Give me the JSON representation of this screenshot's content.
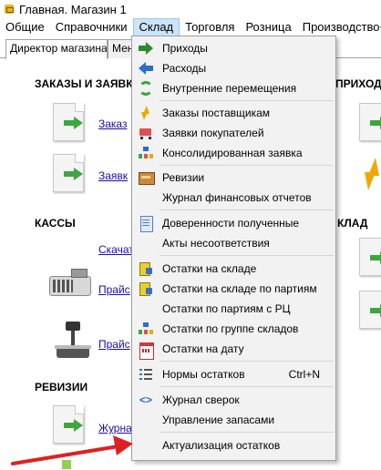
{
  "window": {
    "title": "Главная. Магазин 1"
  },
  "menubar": {
    "items": [
      {
        "label": "Общие"
      },
      {
        "label": "Справочники"
      },
      {
        "label": "Склад"
      },
      {
        "label": "Торговля"
      },
      {
        "label": "Розница"
      },
      {
        "label": "Производство+"
      }
    ]
  },
  "tabs": [
    {
      "label": "Директор магазина"
    },
    {
      "label": "Мен"
    }
  ],
  "content": {
    "sections": {
      "orders": "ЗАКАЗЫ И ЗАЯВКИ",
      "receipts_right": "ПРИХОДЫ",
      "cash": "КАССЫ",
      "warehouse_right": "КЛАД",
      "revisions": "РЕВИЗИИ"
    },
    "links": {
      "orders1": "Заказ",
      "orders2": "Заявк",
      "download": "Скачат",
      "price1": "Прайс",
      "price2": "Прайс",
      "journal": "Журна"
    }
  },
  "dropdown": {
    "items": [
      {
        "label": "Приходы",
        "icon": "incoming-arrow-icon"
      },
      {
        "label": "Расходы",
        "icon": "outgoing-arrow-icon"
      },
      {
        "label": "Внутренние перемещения",
        "icon": "transfer-cycle-icon"
      },
      {
        "label": "Заказы поставщикам",
        "icon": "lightning-icon"
      },
      {
        "label": "Заявки покупателей",
        "icon": "cart-icon"
      },
      {
        "label": "Консолидированная заявка",
        "icon": "hierarchy-icon"
      },
      {
        "label": "Ревизии",
        "icon": "box-icon"
      },
      {
        "label": "Журнал финансовых отчетов",
        "icon": ""
      },
      {
        "label": "Доверенности полученные",
        "icon": "document-icon"
      },
      {
        "label": "Акты несоответствия",
        "icon": ""
      },
      {
        "label": "Остатки на складе",
        "icon": "stock-icon"
      },
      {
        "label": "Остатки на складе по партиям",
        "icon": "stock-icon"
      },
      {
        "label": "Остатки по партиям с РЦ",
        "icon": ""
      },
      {
        "label": "Остатки по группе складов",
        "icon": "hierarchy-icon"
      },
      {
        "label": "Остатки на дату",
        "icon": "calendar-icon"
      },
      {
        "label": "Нормы остатков",
        "icon": "list-icon",
        "shortcut": "Ctrl+N"
      },
      {
        "label": "Журнал сверок",
        "icon": "code-icon",
        "glyph": "<>"
      },
      {
        "label": "Управление запасами",
        "icon": ""
      },
      {
        "label": "Актуализация остатков",
        "icon": ""
      }
    ]
  },
  "colors": {
    "menu_highlight": "#cce4f7",
    "annotation_arrow": "#e02020",
    "link": "#1a0dab"
  }
}
